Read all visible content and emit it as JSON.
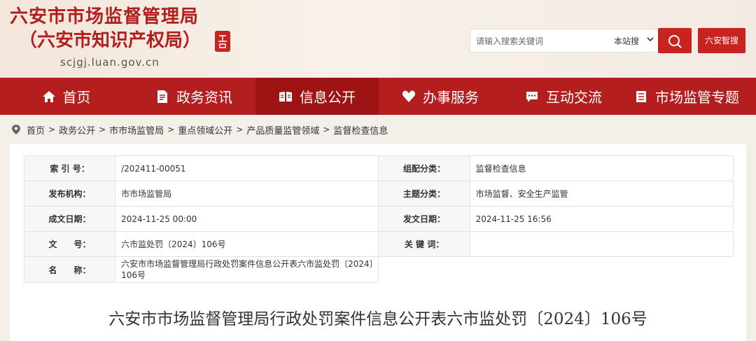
{
  "header": {
    "title_line1": "六安市市场监督管理局",
    "title_line2": "（六安市知识产权局）",
    "seal_text": "六安市",
    "domain": "scjgj.luan.gov.cn",
    "search_placeholder": "请输入搜索关键词",
    "search_scope": "本站搜",
    "smart_button": "六安智搜",
    "accent_color": "#c8241f"
  },
  "nav": {
    "items": [
      {
        "label": "首页",
        "icon": "home-icon"
      },
      {
        "label": "政务资讯",
        "icon": "document-icon"
      },
      {
        "label": "信息公开",
        "icon": "open-book-icon"
      },
      {
        "label": "办事服务",
        "icon": "heart-icon"
      },
      {
        "label": "互动交流",
        "icon": "chat-icon"
      },
      {
        "label": "市场监管专题",
        "icon": "bookmark-icon"
      }
    ],
    "active_index": 2
  },
  "breadcrumb": [
    "首页",
    "政务公开",
    "市市场监管局",
    "重点领域公开",
    "产品质量监管领域",
    "监督检查信息"
  ],
  "meta": {
    "index_label": "索 引 号：",
    "index_value": "/202411-00051",
    "category_label": "组配分类：",
    "category_value": "监督检查信息",
    "publisher_label": "发布机构：",
    "publisher_value": "市市场监管局",
    "topic_label": "主题分类：",
    "topic_value": "市场监督、安全生产监管",
    "created_label": "成文日期：",
    "created_value": "2024-11-25 00:00",
    "issued_label": "发文日期：",
    "issued_value": "2024-11-25 16:56",
    "docno_label": "文　　号：",
    "docno_value": "六市监处罚〔2024〕106号",
    "keywords_label": "关 键 词：",
    "keywords_value": "",
    "name_label": "名　　称：",
    "name_value": "六安市市场监督管理局行政处罚案件信息公开表六市监处罚〔2024〕106号"
  },
  "article": {
    "title": "六安市市场监督管理局行政处罚案件信息公开表六市监处罚〔2024〕106号"
  }
}
